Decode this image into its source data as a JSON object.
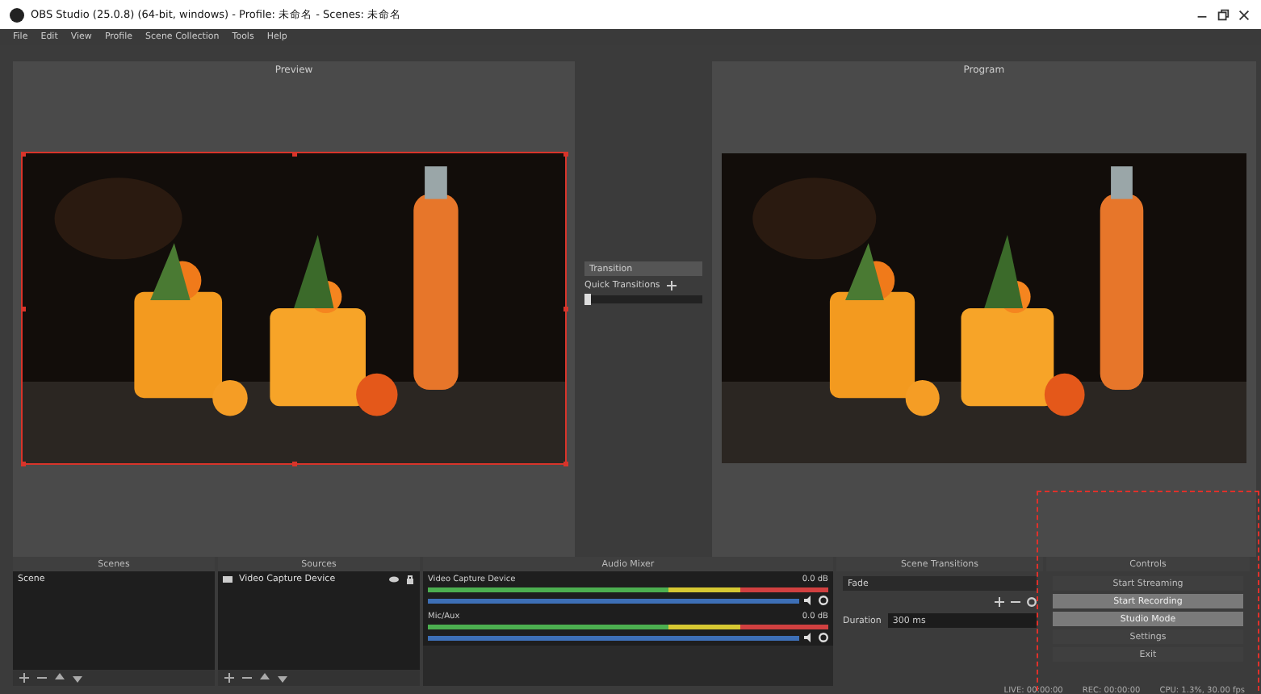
{
  "window": {
    "title": "OBS Studio (25.0.8) (64-bit, windows) - Profile: 未命名 - Scenes: 未命名"
  },
  "menu": [
    "File",
    "Edit",
    "View",
    "Profile",
    "Scene Collection",
    "Tools",
    "Help"
  ],
  "preview": {
    "label": "Preview"
  },
  "transition": {
    "button": "Transition",
    "quick": "Quick Transitions"
  },
  "program": {
    "label": "Program"
  },
  "scenes": {
    "title": "Scenes",
    "items": [
      "Scene"
    ]
  },
  "sources": {
    "title": "Sources",
    "items": [
      "Video Capture Device"
    ]
  },
  "audio": {
    "title": "Audio Mixer",
    "channels": [
      {
        "name": "Video Capture Device",
        "reading": "0.0 dB",
        "level": 1
      },
      {
        "name": "Mic/Aux",
        "reading": "0.0 dB",
        "level": 1
      }
    ]
  },
  "scene_transitions": {
    "title": "Scene Transitions",
    "type": "Fade",
    "duration_label": "Duration",
    "duration": "300 ms"
  },
  "controls": {
    "title": "Controls",
    "buttons": [
      {
        "label": "Start Streaming",
        "active": false
      },
      {
        "label": "Start Recording",
        "active": true
      },
      {
        "label": "Studio Mode",
        "active": true
      },
      {
        "label": "Settings",
        "active": false
      },
      {
        "label": "Exit",
        "active": false
      }
    ]
  },
  "status_bar": [
    "LIVE: 00:00:00",
    "REC: 00:00:00",
    "CPU: 1.3%, 30.00 fps"
  ]
}
